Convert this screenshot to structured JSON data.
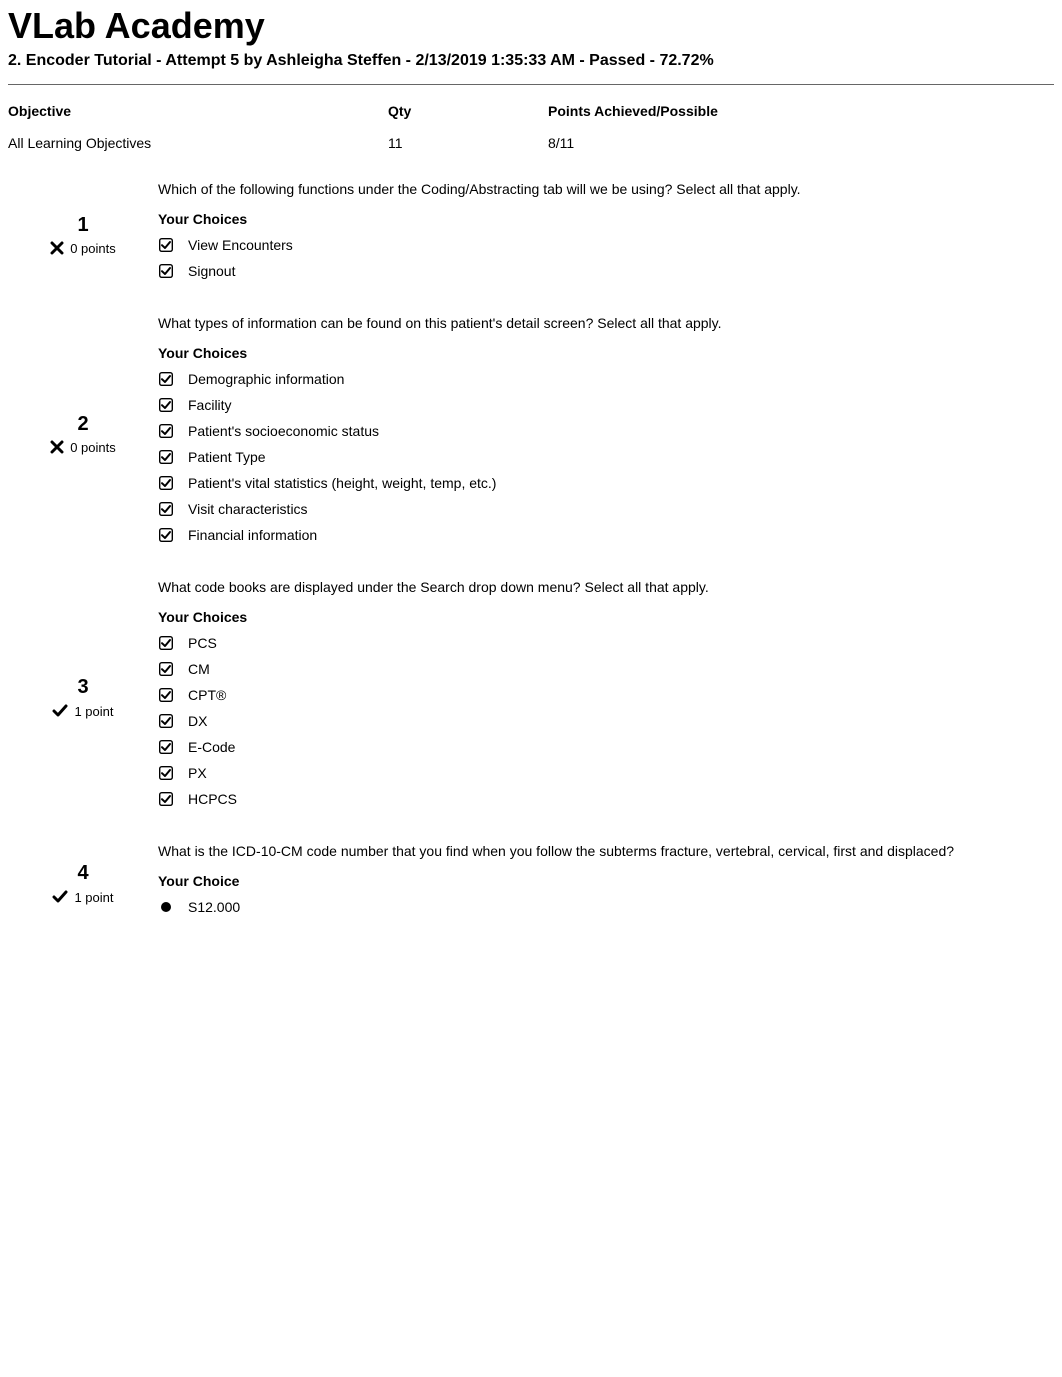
{
  "header": {
    "title": "VLab Academy",
    "subtitle": "2. Encoder Tutorial - Attempt 5 by Ashleigha Steffen - 2/13/2019 1:35:33 AM - Passed - 72.72%"
  },
  "summary": {
    "headers": {
      "objective": "Objective",
      "qty": "Qty",
      "points": "Points Achieved/Possible"
    },
    "row": {
      "objective": "All Learning Objectives",
      "qty": "11",
      "points": "8/11"
    }
  },
  "labels": {
    "your_choices": "Your Choices",
    "your_choice": "Your Choice"
  },
  "questions": [
    {
      "number": "1",
      "status": "incorrect",
      "points_label": "0 points",
      "text": "Which of the following functions under the Coding/Abstracting tab will we be using? Select all that apply.",
      "choices_header": "Your Choices",
      "choice_type": "checkbox",
      "choices": [
        "View Encounters",
        "Signout"
      ]
    },
    {
      "number": "2",
      "status": "incorrect",
      "points_label": "0 points",
      "text": "What types of information can be found on this patient's detail screen? Select all that apply.",
      "choices_header": "Your Choices",
      "choice_type": "checkbox",
      "choices": [
        "Demographic information",
        "Facility",
        "Patient's socioeconomic status",
        "Patient Type",
        "Patient's vital statistics (height, weight, temp, etc.)",
        "Visit characteristics",
        "Financial information"
      ]
    },
    {
      "number": "3",
      "status": "correct",
      "points_label": "1 point",
      "text": "What code books are displayed under the Search drop down menu? Select all that apply.",
      "choices_header": "Your Choices",
      "choice_type": "checkbox",
      "choices": [
        "PCS",
        "CM",
        "CPT®",
        "DX",
        "E-Code",
        "PX",
        "HCPCS"
      ]
    },
    {
      "number": "4",
      "status": "correct",
      "points_label": "1 point",
      "text": "What is the ICD-10-CM code number that you find when you follow the subterms fracture, vertebral, cervical, first and displaced?",
      "choices_header": "Your Choice",
      "choice_type": "radio",
      "choices": [
        "S12.000"
      ]
    }
  ]
}
